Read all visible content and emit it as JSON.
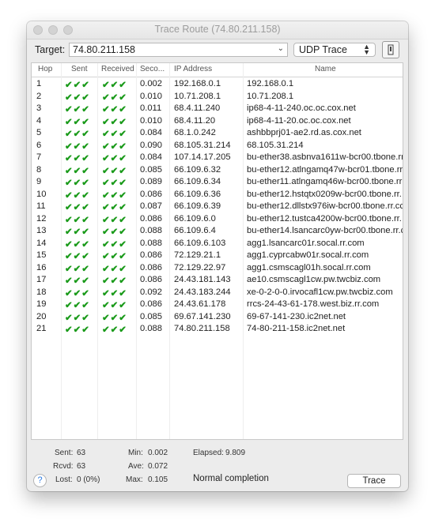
{
  "window": {
    "title": "Trace Route (74.80.211.158)"
  },
  "toolbar": {
    "target_label": "Target:",
    "target_value": "74.80.211.158",
    "mode_value": "UDP Trace"
  },
  "table": {
    "headers": [
      "Hop",
      "Sent",
      "Received",
      "Seco...",
      "IP Address",
      "Name"
    ],
    "rows": [
      {
        "hop": "1",
        "sent": "✔✔✔",
        "recv": "✔✔✔",
        "sec": "0.002",
        "ip": "192.168.0.1",
        "name": "192.168.0.1"
      },
      {
        "hop": "2",
        "sent": "✔✔✔",
        "recv": "✔✔✔",
        "sec": "0.010",
        "ip": "10.71.208.1",
        "name": "10.71.208.1"
      },
      {
        "hop": "3",
        "sent": "✔✔✔",
        "recv": "✔✔✔",
        "sec": "0.011",
        "ip": "68.4.11.240",
        "name": "ip68-4-11-240.oc.oc.cox.net"
      },
      {
        "hop": "4",
        "sent": "✔✔✔",
        "recv": "✔✔✔",
        "sec": "0.010",
        "ip": "68.4.11.20",
        "name": "ip68-4-11-20.oc.oc.cox.net"
      },
      {
        "hop": "5",
        "sent": "✔✔✔",
        "recv": "✔✔✔",
        "sec": "0.084",
        "ip": "68.1.0.242",
        "name": "ashbbprj01-ae2.rd.as.cox.net"
      },
      {
        "hop": "6",
        "sent": "✔✔✔",
        "recv": "✔✔✔",
        "sec": "0.090",
        "ip": "68.105.31.214",
        "name": "68.105.31.214"
      },
      {
        "hop": "7",
        "sent": "✔✔✔",
        "recv": "✔✔✔",
        "sec": "0.084",
        "ip": "107.14.17.205",
        "name": "bu-ether38.asbnva1611w-bcr00.tbone.rr"
      },
      {
        "hop": "8",
        "sent": "✔✔✔",
        "recv": "✔✔✔",
        "sec": "0.085",
        "ip": "66.109.6.32",
        "name": "bu-ether12.atlngamq47w-bcr01.tbone.rr"
      },
      {
        "hop": "9",
        "sent": "✔✔✔",
        "recv": "✔✔✔",
        "sec": "0.089",
        "ip": "66.109.6.34",
        "name": "bu-ether11.atlngamq46w-bcr00.tbone.rr"
      },
      {
        "hop": "10",
        "sent": "✔✔✔",
        "recv": "✔✔✔",
        "sec": "0.086",
        "ip": "66.109.6.36",
        "name": "bu-ether12.hstqtx0209w-bcr00.tbone.rr."
      },
      {
        "hop": "11",
        "sent": "✔✔✔",
        "recv": "✔✔✔",
        "sec": "0.087",
        "ip": "66.109.6.39",
        "name": "bu-ether12.dllstx976iw-bcr00.tbone.rr.cc"
      },
      {
        "hop": "12",
        "sent": "✔✔✔",
        "recv": "✔✔✔",
        "sec": "0.086",
        "ip": "66.109.6.0",
        "name": "bu-ether12.tustca4200w-bcr00.tbone.rr."
      },
      {
        "hop": "13",
        "sent": "✔✔✔",
        "recv": "✔✔✔",
        "sec": "0.088",
        "ip": "66.109.6.4",
        "name": "bu-ether14.lsancarc0yw-bcr00.tbone.rr.c"
      },
      {
        "hop": "14",
        "sent": "✔✔✔",
        "recv": "✔✔✔",
        "sec": "0.088",
        "ip": "66.109.6.103",
        "name": "agg1.lsancarc01r.socal.rr.com"
      },
      {
        "hop": "15",
        "sent": "✔✔✔",
        "recv": "✔✔✔",
        "sec": "0.086",
        "ip": "72.129.21.1",
        "name": "agg1.cyprcabw01r.socal.rr.com"
      },
      {
        "hop": "16",
        "sent": "✔✔✔",
        "recv": "✔✔✔",
        "sec": "0.086",
        "ip": "72.129.22.97",
        "name": "agg1.csmscagl01h.socal.rr.com"
      },
      {
        "hop": "17",
        "sent": "✔✔✔",
        "recv": "✔✔✔",
        "sec": "0.086",
        "ip": "24.43.181.143",
        "name": "ae10.csmscagl1cw.pw.twcbiz.com"
      },
      {
        "hop": "18",
        "sent": "✔✔✔",
        "recv": "✔✔✔",
        "sec": "0.092",
        "ip": "24.43.183.244",
        "name": "xe-0-2-0-0.irvocafl1cw.pw.twcbiz.com"
      },
      {
        "hop": "19",
        "sent": "✔✔✔",
        "recv": "✔✔✔",
        "sec": "0.086",
        "ip": "24.43.61.178",
        "name": "rrcs-24-43-61-178.west.biz.rr.com"
      },
      {
        "hop": "20",
        "sent": "✔✔✔",
        "recv": "✔✔✔",
        "sec": "0.085",
        "ip": "69.67.141.230",
        "name": "69-67-141-230.ic2net.net"
      },
      {
        "hop": "21",
        "sent": "✔✔✔",
        "recv": "✔✔✔",
        "sec": "0.088",
        "ip": "74.80.211.158",
        "name": "74-80-211-158.ic2net.net"
      }
    ]
  },
  "stats": {
    "sent_label": "Sent:",
    "sent": "63",
    "rcvd_label": "Rcvd:",
    "rcvd": "63",
    "lost_label": "Lost:",
    "lost": "0 (0%)",
    "min_label": "Min:",
    "min": "0.002",
    "ave_label": "Ave:",
    "ave": "0.072",
    "max_label": "Max:",
    "max": "0.105",
    "elapsed_label": "Elapsed:",
    "elapsed": "9.809",
    "status": "Normal completion"
  },
  "buttons": {
    "help": "?",
    "trace": "Trace"
  },
  "colors": {
    "check": "#1a9a1a",
    "help": "#2a7ae2"
  }
}
